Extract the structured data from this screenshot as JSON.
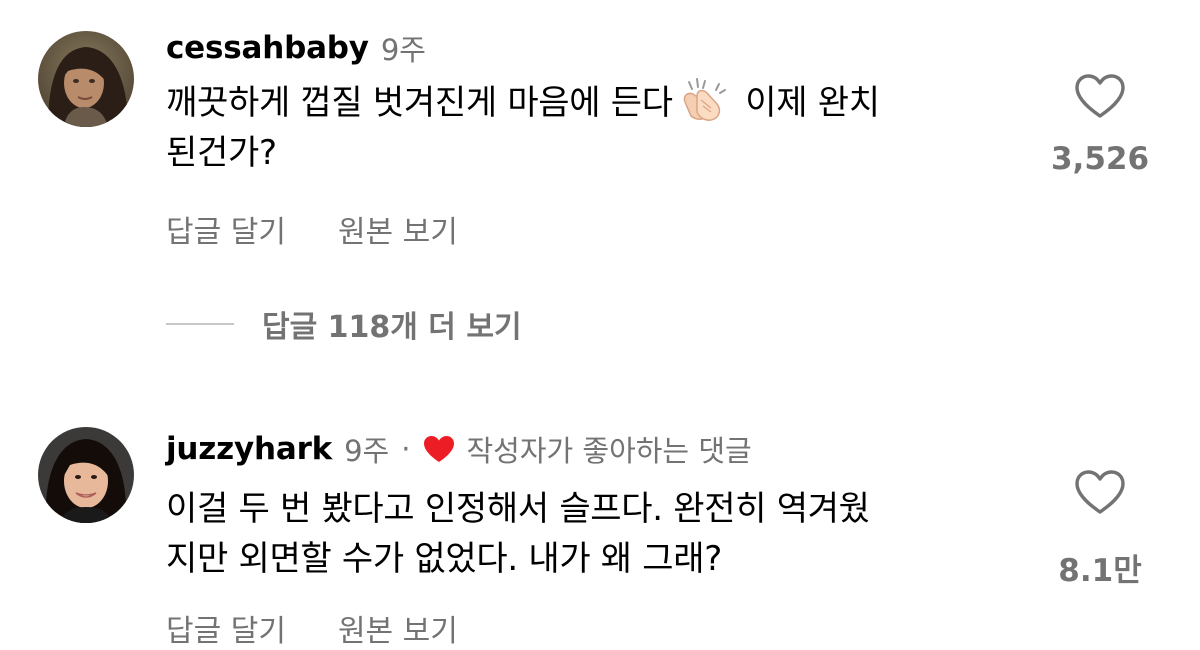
{
  "comments": [
    {
      "username": "cessahbaby",
      "time": "9주",
      "body_line1_before": "깨끗하게 껍질 벗겨진게 마음에 든다",
      "body_line1_after": " 이제 완치",
      "body_line2": "된건가?",
      "emoji": "clapping-hands",
      "like_count": "3,526",
      "reply_label": "답글 달기",
      "original_label": "원본 보기",
      "replies_label": "답글 118개 더 보기"
    },
    {
      "username": "juzzyhark",
      "time": "9주",
      "separator": "·",
      "author_liked": "작성자가 좋아하는 댓글",
      "body_line1": "이걸 두 번 봤다고 인정해서 슬프다. 완전히 역겨웠",
      "body_line2": "지만 외면할 수가 없었다. 내가 왜 그래?",
      "like_count": "8.1만",
      "reply_label": "답글 달기",
      "original_label": "원본 보기"
    }
  ],
  "colors": {
    "secondary_text": "#737373",
    "heart_red": "#ed1d25",
    "divider": "#c7c7c7"
  }
}
